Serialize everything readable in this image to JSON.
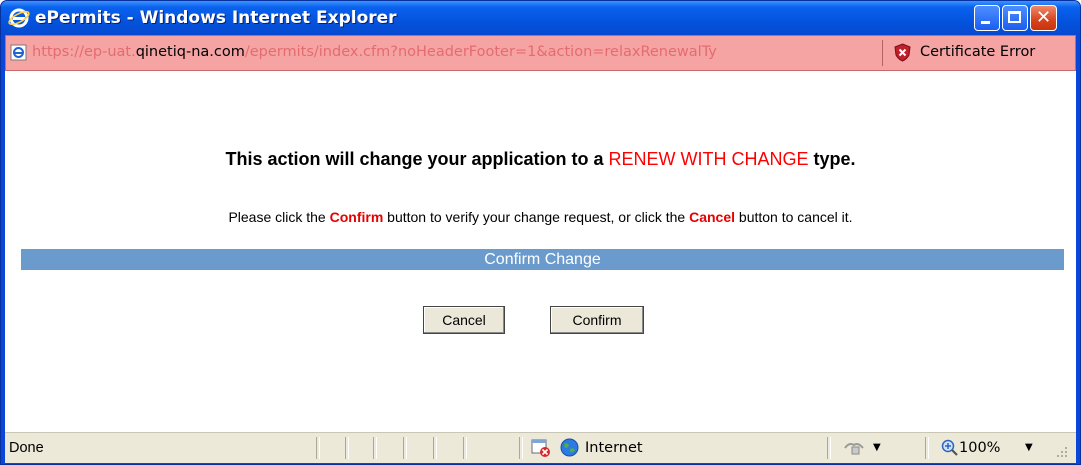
{
  "window": {
    "title": "ePermits - Windows Internet Explorer",
    "minimize_icon": "minimize-icon",
    "maximize_icon": "maximize-icon",
    "close_icon": "close-icon"
  },
  "address_bar": {
    "url_prefix": "https://ep-uat.",
    "url_host": "qinetiq-na.com",
    "url_rest": "/epermits/index.cfm?noHeaderFooter=1&action=relaxRenewalTy",
    "certificate_label": "Certificate Error",
    "page_icon": "ie-page-icon",
    "certificate_icon": "shield-x-icon"
  },
  "main": {
    "headline_pre": "This action will change your application to a ",
    "headline_highlight": "RENEW WITH CHANGE",
    "headline_post": " type.",
    "instr_pre": "Please click the ",
    "instr_confirm": "Confirm",
    "instr_mid": " button to verify your change request, or click the ",
    "instr_cancel": "Cancel",
    "instr_post": " button to cancel it.",
    "section_title": "Confirm Change",
    "cancel_label": "Cancel",
    "confirm_label": "Confirm"
  },
  "status_bar": {
    "status_text": "Done",
    "zone_label": "Internet",
    "zoom_label": "100%",
    "caret": "▼"
  },
  "colors": {
    "title_bar": "#0453dd",
    "address_bar_error": "#f6a3a4",
    "highlight_red": "#ff0000",
    "section_bar": "#6b9bcc"
  }
}
